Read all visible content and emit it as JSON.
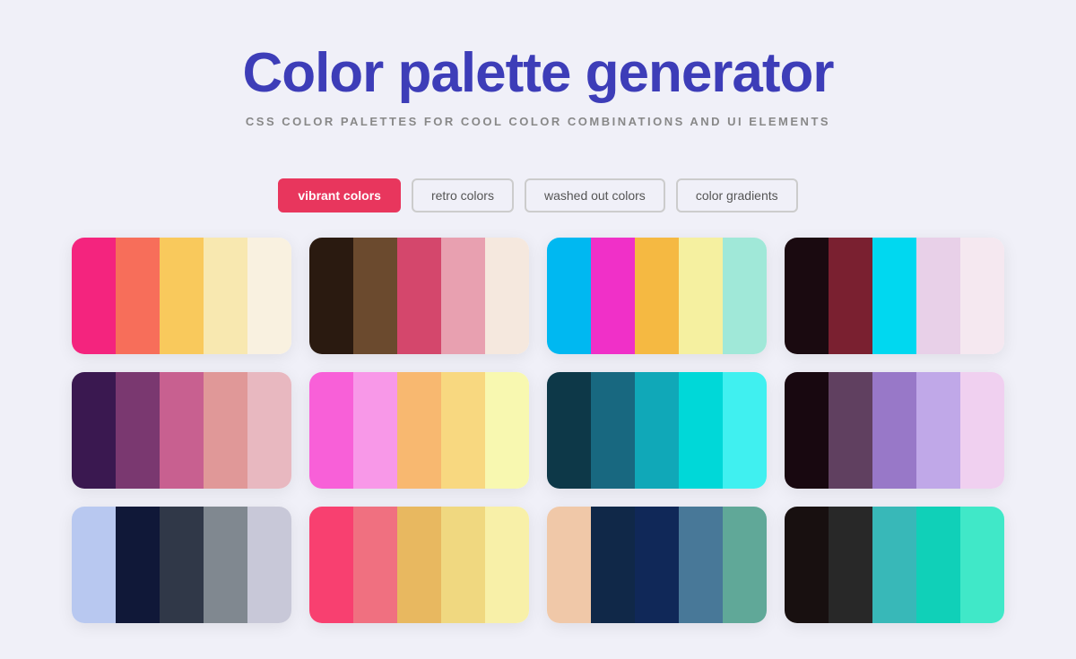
{
  "header": {
    "title": "Color palette generator",
    "subtitle": "CSS COLOR PALETTES FOR COOL COLOR COMBINATIONS AND UI ELEMENTS"
  },
  "filters": [
    {
      "id": "vibrant",
      "label": "vibrant colors",
      "active": true
    },
    {
      "id": "retro",
      "label": "retro colors",
      "active": false
    },
    {
      "id": "washed",
      "label": "washed out colors",
      "active": false
    },
    {
      "id": "gradients",
      "label": "color gradients",
      "active": false
    }
  ],
  "palettes": [
    {
      "id": "p1",
      "colors": [
        "#f4247e",
        "#f76e5a",
        "#f9c95c",
        "#f8e8b0",
        "#f9f1e0"
      ]
    },
    {
      "id": "p2",
      "colors": [
        "#2a1a10",
        "#6b4a2e",
        "#d4476c",
        "#e8a0b0",
        "#f5e8de"
      ]
    },
    {
      "id": "p3",
      "colors": [
        "#00b8f1",
        "#f030c8",
        "#f5b942",
        "#f5f0a0",
        "#a0e8d8"
      ]
    },
    {
      "id": "p4",
      "colors": [
        "#1a0a10",
        "#7a2030",
        "#00d8f0",
        "#e8d0e8",
        "#f5e8f0"
      ]
    },
    {
      "id": "p5",
      "colors": [
        "#3a1850",
        "#7a3870",
        "#c86090",
        "#e09898",
        "#e8b8c0"
      ]
    },
    {
      "id": "p6",
      "colors": [
        "#f860d8",
        "#f898e8",
        "#f8b870",
        "#f8d880",
        "#f8f8b0"
      ]
    },
    {
      "id": "p7",
      "colors": [
        "#0d3848",
        "#186880",
        "#10a8b8",
        "#00d8d8",
        "#40f0f0"
      ]
    },
    {
      "id": "p8",
      "colors": [
        "#180810",
        "#604060",
        "#9878c8",
        "#c0a8e8",
        "#f0d0f0"
      ]
    },
    {
      "id": "p9",
      "colors": [
        "#b8c8f0",
        "#101838",
        "#303848",
        "#808890",
        "#c8c8d8"
      ]
    },
    {
      "id": "p10",
      "colors": [
        "#f84070",
        "#f07080",
        "#e8b860",
        "#f0d880",
        "#f8f0a8"
      ]
    },
    {
      "id": "p11",
      "colors": [
        "#f0c8a8",
        "#102848",
        "#102858",
        "#487898",
        "#60a898"
      ]
    },
    {
      "id": "p12",
      "colors": [
        "#181010",
        "#282828",
        "#38b8b8",
        "#10d0b8",
        "#40e8c8"
      ]
    }
  ]
}
